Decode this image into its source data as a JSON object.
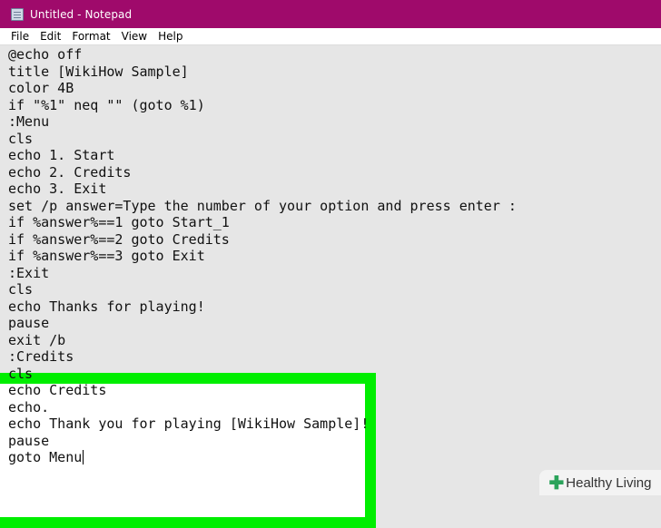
{
  "window": {
    "title": "Untitled - Notepad"
  },
  "menu": [
    "File",
    "Edit",
    "Format",
    "View",
    "Help"
  ],
  "editor": {
    "lines": [
      "@echo off",
      "title [WikiHow Sample]",
      "color 4B",
      "if \"%1\" neq \"\" (goto %1)",
      ":Menu",
      "cls",
      "echo 1. Start",
      "echo 2. Credits",
      "echo 3. Exit",
      "set /p answer=Type the number of your option and press enter :",
      "if %answer%==1 goto Start_1",
      "if %answer%==2 goto Credits",
      "if %answer%==3 goto Exit",
      ":Exit",
      "cls",
      "echo Thanks for playing!",
      "pause",
      "exit /b",
      ":Credits",
      "cls",
      "echo Credits",
      "echo.",
      "echo Thank you for playing [WikiHow Sample]!",
      "pause",
      "goto Menu"
    ]
  },
  "watermark": {
    "text": "Healthy Living"
  },
  "colors": {
    "titlebar": "#9f0a6b",
    "highlight_border": "#00ee00",
    "editor_bg": "#e6e6e6"
  }
}
